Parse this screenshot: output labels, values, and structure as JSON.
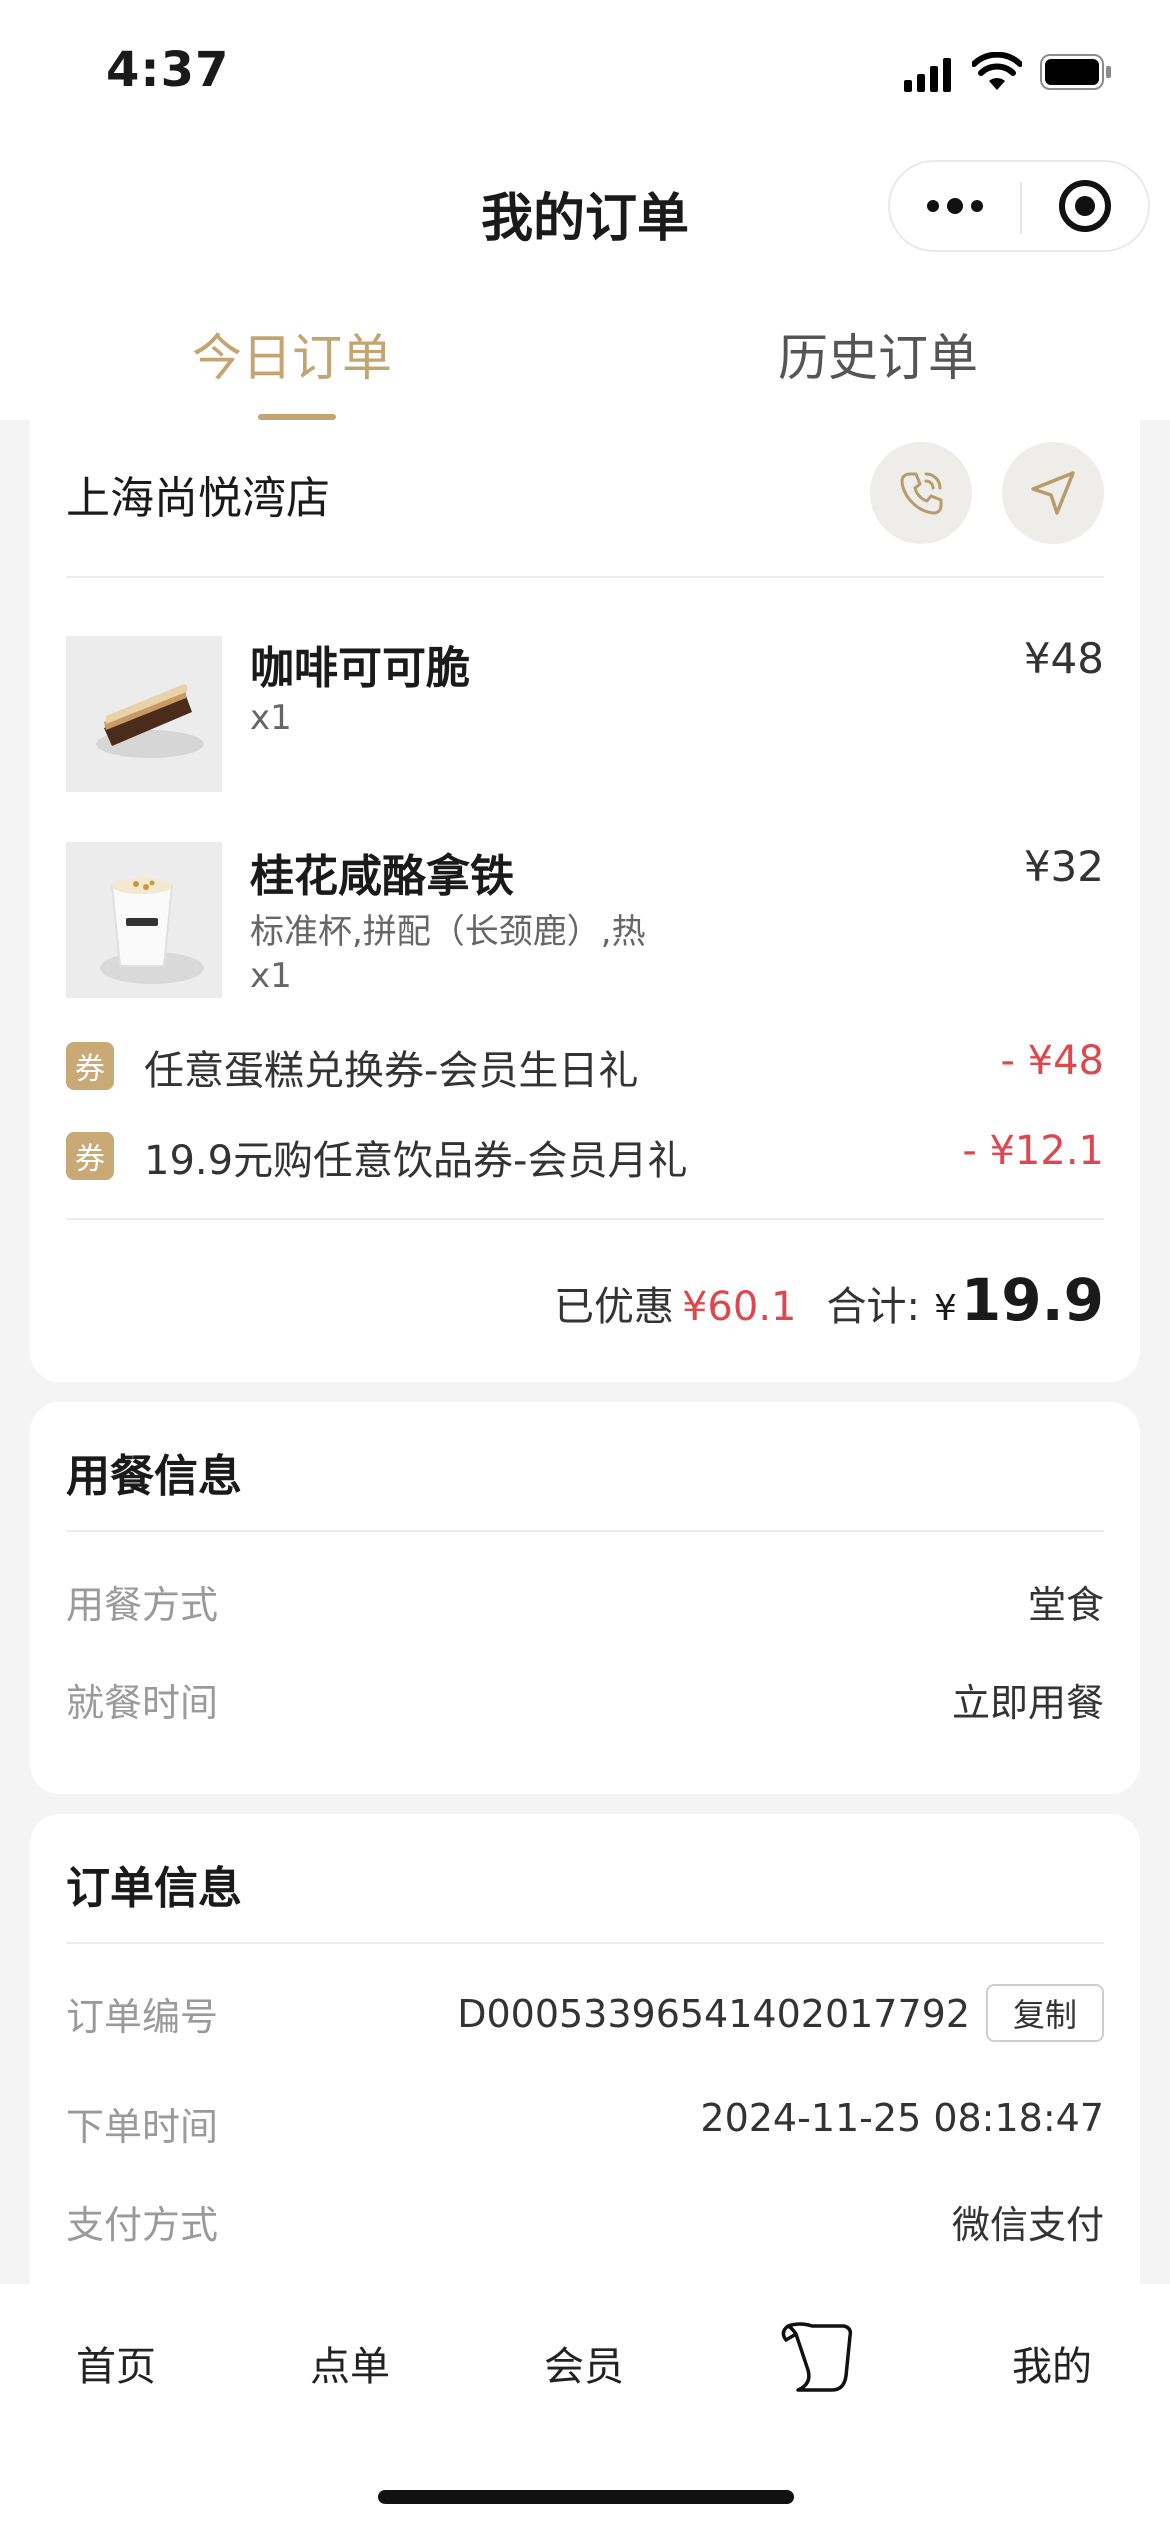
{
  "status_bar": {
    "time": "4:37"
  },
  "header": {
    "title": "我的订单"
  },
  "tabs": [
    {
      "label": "今日订单",
      "active": true
    },
    {
      "label": "历史订单",
      "active": false
    }
  ],
  "order": {
    "store_name": "上海尚悦湾店",
    "items": [
      {
        "name": "咖啡可可脆",
        "spec": "",
        "qty": "x1",
        "price": "¥48"
      },
      {
        "name": "桂花咸酪拿铁",
        "spec": "标准杯,拼配（长颈鹿）,热",
        "qty": "x1",
        "price": "¥32"
      }
    ],
    "coupons": [
      {
        "badge": "券",
        "text": "任意蛋糕兑换券-会员生日礼",
        "amount": "- ¥48"
      },
      {
        "badge": "券",
        "text": "19.9元购任意饮品券-会员月礼",
        "amount": "- ¥12.1"
      }
    ],
    "summary": {
      "discount_label": "已优惠",
      "discount_value": "¥60.1",
      "total_label": "合计:",
      "currency": "¥",
      "total_value": "19.9"
    }
  },
  "dining_info": {
    "title": "用餐信息",
    "rows": [
      {
        "label": "用餐方式",
        "value": "堂食"
      },
      {
        "label": "就餐时间",
        "value": "立即用餐"
      }
    ]
  },
  "order_info": {
    "title": "订单信息",
    "copy_label": "复制",
    "rows": [
      {
        "label": "订单编号",
        "value": "D0005339654140201779​2"
      },
      {
        "label": "下单时间",
        "value": "2024-11-25 08:18:47"
      },
      {
        "label": "支付方式",
        "value": "微信支付"
      }
    ]
  },
  "tabbar": {
    "items": [
      {
        "label": "首页"
      },
      {
        "label": "点单"
      },
      {
        "label": "会员"
      },
      {
        "icon": "scroll-icon"
      },
      {
        "label": "我的"
      }
    ]
  },
  "colors": {
    "accent": "#c4a572",
    "discount_red": "#e0474c",
    "coupon_badge": "#c9aa77"
  }
}
